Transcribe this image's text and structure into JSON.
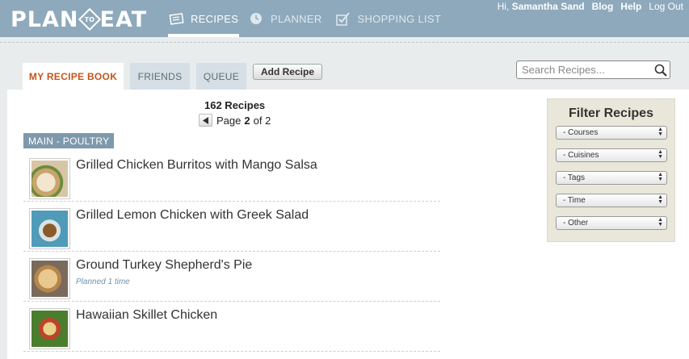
{
  "header": {
    "logo": {
      "left": "PLAN",
      "middle": "TO",
      "right": "EAT"
    },
    "nav": [
      {
        "label": "RECIPES",
        "icon": "recipe-card-icon",
        "active": true
      },
      {
        "label": "PLANNER",
        "icon": "clock-icon",
        "active": false
      },
      {
        "label": "SHOPPING LIST",
        "icon": "checklist-icon",
        "active": false
      }
    ],
    "user": {
      "greeting": "Hi,",
      "name": "Samantha Sand",
      "links": [
        "Blog",
        "Help",
        "Log Out"
      ]
    }
  },
  "tabs": [
    {
      "label": "MY RECIPE BOOK",
      "active": true
    },
    {
      "label": "FRIENDS",
      "active": false
    },
    {
      "label": "QUEUE",
      "active": false
    }
  ],
  "add_recipe_label": "Add Recipe",
  "search": {
    "placeholder": "Search Recipes..."
  },
  "results": {
    "count_text": "162 Recipes",
    "page_prefix": "Page",
    "page_current": "2",
    "page_sep": "of",
    "page_total": "2"
  },
  "category": "MAIN - POULTRY",
  "recipes": [
    {
      "title": "Grilled Chicken Burritos with Mango Salsa",
      "note": ""
    },
    {
      "title": "Grilled Lemon Chicken with Greek Salad",
      "note": ""
    },
    {
      "title": "Ground Turkey Shepherd's Pie",
      "note": "Planned 1 time"
    },
    {
      "title": "Hawaiian Skillet Chicken",
      "note": ""
    }
  ],
  "filter": {
    "title": "Filter Recipes",
    "selects": [
      "- Courses",
      "- Cuisines",
      "- Tags",
      "- Time",
      "- Other"
    ]
  },
  "colors": {
    "header": "#8ea9bc",
    "accent": "#c1551c",
    "category": "#7f99ac",
    "filter_bg": "#e9e7d9"
  }
}
